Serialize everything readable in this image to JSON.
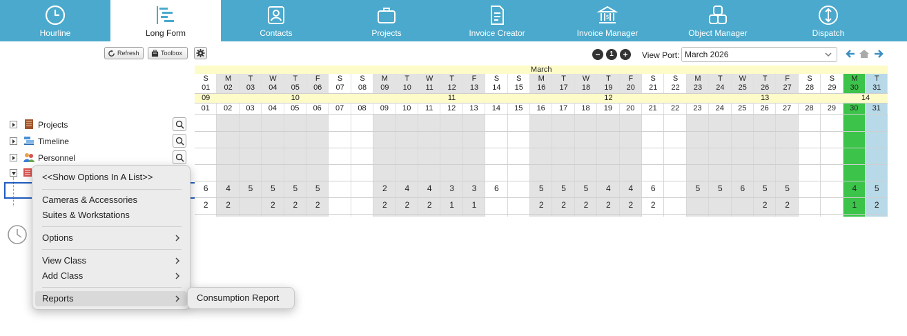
{
  "nav": {
    "tabs": [
      {
        "label": "Hourline",
        "icon": "clock-icon"
      },
      {
        "label": "Long Form",
        "icon": "gantt-icon",
        "active": true
      },
      {
        "label": "Contacts",
        "icon": "contact-card-icon"
      },
      {
        "label": "Projects",
        "icon": "briefcase-icon"
      },
      {
        "label": "Invoice Creator",
        "icon": "document-icon"
      },
      {
        "label": "Invoice Manager",
        "icon": "bank-icon"
      },
      {
        "label": "Object Manager",
        "icon": "shapes-icon"
      },
      {
        "label": "Dispatch",
        "icon": "dispatch-arrows-icon"
      }
    ],
    "bg_color": "#4aa9cc"
  },
  "toolbar": {
    "refresh_label": "Refresh",
    "toolbox_label": "Toolbox",
    "zoom_out": "−",
    "zoom_reset": "1",
    "zoom_in": "+",
    "viewport_label": "View Port:",
    "viewport_value": "March 2026"
  },
  "tree": {
    "items": [
      {
        "label": "Projects",
        "icon": "ledger-icon"
      },
      {
        "label": "Timeline",
        "icon": "timeline-icon"
      },
      {
        "label": "Personnel",
        "icon": "people-icon"
      }
    ]
  },
  "calendar": {
    "month": "March",
    "days": [
      {
        "dow": "S",
        "day": "01",
        "weekend": true
      },
      {
        "dow": "M",
        "day": "02"
      },
      {
        "dow": "T",
        "day": "03"
      },
      {
        "dow": "W",
        "day": "04"
      },
      {
        "dow": "T",
        "day": "05"
      },
      {
        "dow": "F",
        "day": "06"
      },
      {
        "dow": "S",
        "day": "07",
        "weekend": true
      },
      {
        "dow": "S",
        "day": "08",
        "weekend": true
      },
      {
        "dow": "M",
        "day": "09"
      },
      {
        "dow": "T",
        "day": "10"
      },
      {
        "dow": "W",
        "day": "11"
      },
      {
        "dow": "T",
        "day": "12"
      },
      {
        "dow": "F",
        "day": "13"
      },
      {
        "dow": "S",
        "day": "14",
        "weekend": true
      },
      {
        "dow": "S",
        "day": "15",
        "weekend": true
      },
      {
        "dow": "M",
        "day": "16"
      },
      {
        "dow": "T",
        "day": "17"
      },
      {
        "dow": "W",
        "day": "18"
      },
      {
        "dow": "T",
        "day": "19"
      },
      {
        "dow": "F",
        "day": "20"
      },
      {
        "dow": "S",
        "day": "21",
        "weekend": true
      },
      {
        "dow": "S",
        "day": "22",
        "weekend": true
      },
      {
        "dow": "M",
        "day": "23"
      },
      {
        "dow": "T",
        "day": "24"
      },
      {
        "dow": "W",
        "day": "25"
      },
      {
        "dow": "T",
        "day": "26"
      },
      {
        "dow": "F",
        "day": "27"
      },
      {
        "dow": "S",
        "day": "28",
        "weekend": true
      },
      {
        "dow": "S",
        "day": "29",
        "weekend": true
      },
      {
        "dow": "M",
        "day": "30",
        "today": true
      },
      {
        "dow": "T",
        "day": "31",
        "selected": true
      }
    ],
    "weeks": [
      {
        "label": "09",
        "start": 0,
        "span": 1
      },
      {
        "label": "10",
        "start": 1,
        "span": 7
      },
      {
        "label": "11",
        "start": 8,
        "span": 7
      },
      {
        "label": "12",
        "start": 15,
        "span": 7
      },
      {
        "label": "13",
        "start": 22,
        "span": 7
      },
      {
        "label": "14",
        "start": 29,
        "span": 2
      }
    ],
    "row1": [
      "6",
      "4",
      "5",
      "5",
      "5",
      "5",
      "",
      "",
      "2",
      "4",
      "4",
      "3",
      "3",
      "6",
      "",
      "5",
      "5",
      "5",
      "4",
      "4",
      "6",
      "",
      "5",
      "5",
      "6",
      "5",
      "5",
      "",
      "",
      "4",
      "5"
    ],
    "row2": [
      "2",
      "2",
      "",
      "2",
      "2",
      "2",
      "",
      "",
      "2",
      "2",
      "2",
      "1",
      "1",
      "",
      "",
      "2",
      "2",
      "2",
      "2",
      "2",
      "2",
      "",
      "",
      "",
      "",
      "2",
      "2",
      "",
      "",
      "1",
      "2"
    ],
    "colors": {
      "weekday_bg": "#e3e3e3",
      "today_bg": "#3cc44a",
      "selected_bg": "#b8d9e8",
      "month_bg": "#fdfbc8",
      "highlight_border": "#1e5bbf"
    }
  },
  "context_menu": {
    "items": [
      {
        "label": "<<Show Options In A List>>",
        "submenu": false
      },
      {
        "label": "Cameras & Accessories",
        "submenu": false
      },
      {
        "label": "Suites & Workstations",
        "submenu": false
      },
      {
        "label": "Options",
        "submenu": true
      },
      {
        "label": "View Class",
        "submenu": true
      },
      {
        "label": "Add Class",
        "submenu": true
      },
      {
        "label": "Reports",
        "submenu": true,
        "highlighted": true
      }
    ],
    "submenu": {
      "label": "Consumption Report"
    }
  }
}
